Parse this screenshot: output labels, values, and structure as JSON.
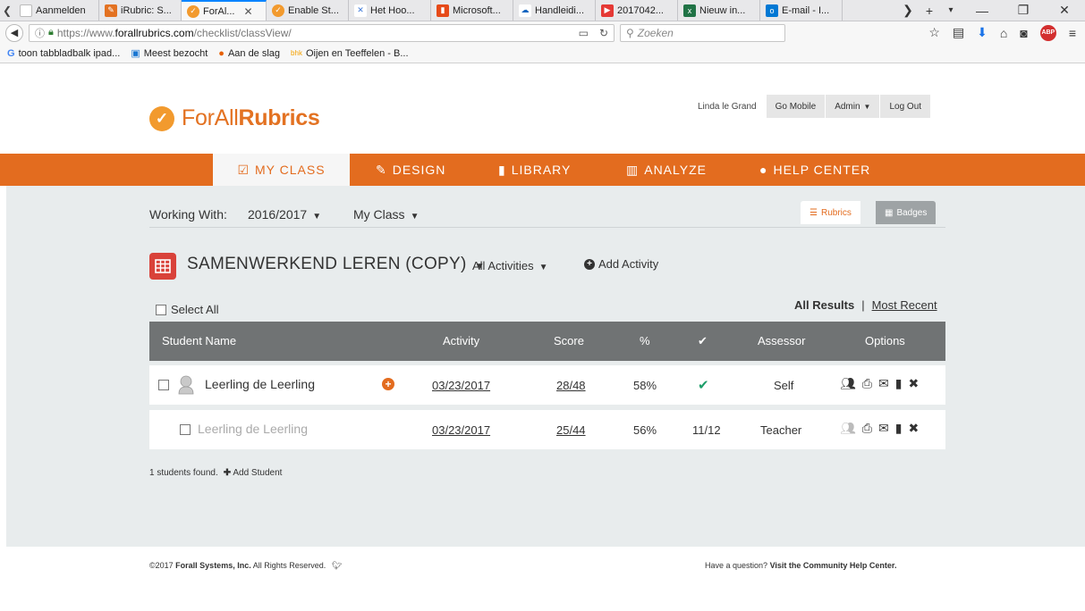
{
  "browser": {
    "tabs": [
      {
        "label": "Aanmelden",
        "icon": "blank-icon",
        "color": "#e8e8ea"
      },
      {
        "label": "iRubric: S...",
        "icon": "irubric-icon",
        "color": "#e37222"
      },
      {
        "label": "ForAl...",
        "icon": "forall-icon",
        "color": "#f29a2e",
        "active": true
      },
      {
        "label": "Enable St...",
        "icon": "forall-icon",
        "color": "#f29a2e"
      },
      {
        "label": "Het Hoo...",
        "icon": "tool-icon",
        "color": "#3c78d8"
      },
      {
        "label": "Microsoft...",
        "icon": "office-icon",
        "color": "#e64a19"
      },
      {
        "label": "Handleidi...",
        "icon": "onedrive-icon",
        "color": "#1565c0"
      },
      {
        "label": "2017042...",
        "icon": "youtube-icon",
        "color": "#e53935"
      },
      {
        "label": "Nieuw in...",
        "icon": "excel-icon",
        "color": "#217346"
      },
      {
        "label": "E-mail - I...",
        "icon": "outlook-icon",
        "color": "#0078d4"
      }
    ],
    "url": {
      "prefix": "https://www.",
      "host": "forallrubrics.com",
      "path": "/checklist/classView/"
    },
    "search_placeholder": "Zoeken",
    "bookmarks": [
      {
        "label": "toon tabbladbalk ipad...",
        "icon": "google-icon"
      },
      {
        "label": "Meest bezocht",
        "icon": "most-visited-icon"
      },
      {
        "label": "Aan de slag",
        "icon": "firefox-icon"
      },
      {
        "label": "Oijen en Teeffelen - B...",
        "icon": "bookmark-icon"
      }
    ]
  },
  "header": {
    "logo_prefix": "ForAll",
    "logo_suffix": "Rubrics",
    "user_name": "Linda le Grand",
    "go_mobile": "Go Mobile",
    "admin": "Admin",
    "logout": "Log Out"
  },
  "nav": {
    "my_class": "MY CLASS",
    "design": "DESIGN",
    "library": "LIBRARY",
    "analyze": "ANALYZE",
    "help_center": "HELP CENTER"
  },
  "working": {
    "label": "Working With:",
    "year": "2016/2017",
    "class": "My Class",
    "rubrics_tab": "Rubrics",
    "badges_tab": "Badges"
  },
  "rubric": {
    "title": "SAMENWERKEND LEREN (COPY)",
    "activities_filter": "All Activities",
    "add_activity": "Add Activity"
  },
  "table": {
    "select_all": "Select All",
    "all_results": "All Results",
    "separator": "|",
    "most_recent": "Most Recent",
    "headers": {
      "student_name": "Student Name",
      "activity": "Activity",
      "score": "Score",
      "percent": "%",
      "assessor": "Assessor",
      "options": "Options"
    },
    "rows": [
      {
        "name": "Leerling de Leerling",
        "activity": "03/23/2017",
        "score": "28/48",
        "percent": "58%",
        "check": "✔",
        "assessor": "Self"
      },
      {
        "name": "Leerling de Leerling",
        "activity": "03/23/2017",
        "score": "25/44",
        "percent": "56%",
        "check": "11/12",
        "assessor": "Teacher"
      }
    ],
    "found": "1 students found.",
    "add_student": "Add Student"
  },
  "footer": {
    "copyright_prefix": "©2017",
    "company": "Forall Systems, Inc.",
    "rights": "All Rights Reserved.",
    "question": "Have a question?",
    "help_link": "Visit the Community Help Center."
  },
  "colors": {
    "brand_orange": "#e36c1f",
    "header_grey": "#707374",
    "content_bg": "#e8eced",
    "rubric_red": "#d9423a",
    "check_green": "#1e9e6a"
  }
}
